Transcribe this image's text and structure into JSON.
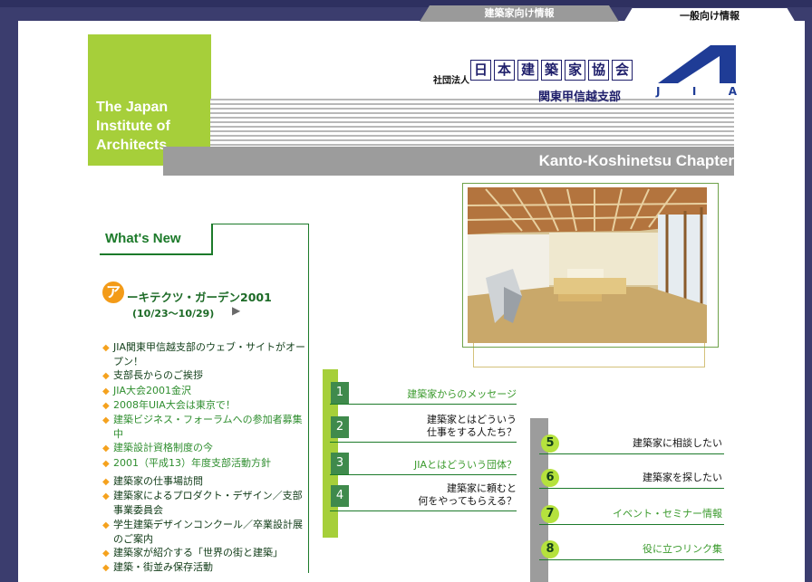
{
  "tabs": [
    {
      "label": "建築家向け情報"
    },
    {
      "label": "一般向け情報"
    }
  ],
  "logo": {
    "text": "The Japan\nInstitute of\nArchitects"
  },
  "header": {
    "org_prefix": "社団法人",
    "org_chars": [
      "日",
      "本",
      "建",
      "築",
      "家",
      "協",
      "会"
    ],
    "branch": "関東甲信越支部",
    "mark_letters": [
      "J",
      "I",
      "A"
    ],
    "chapter": "Kanto-Koshinetsu Chapter"
  },
  "whats_new": {
    "title": "What's New",
    "feature": {
      "icon": "ア",
      "title": "ーキテクツ・ガーデン2001",
      "date": "(10/23〜10/29)",
      "arrow": "▶"
    },
    "news_group1": [
      {
        "text": "JIA関東甲信越支部のウェブ・サイトがオープン！",
        "color": "dark"
      },
      {
        "text": "支部長からのご挨拶",
        "color": "dark"
      },
      {
        "text": "JIA大会2001金沢",
        "color": "green"
      },
      {
        "text": "2008年UIA大会は東京で！",
        "color": "green"
      },
      {
        "text": "建築ビジネス・フォーラムへの参加者募集中",
        "color": "green"
      },
      {
        "text": "建築設計資格制度の今",
        "color": "green"
      },
      {
        "text": "2001（平成13）年度支部活動方針",
        "color": "green"
      }
    ],
    "news_group2": [
      {
        "text": "建築家の仕事場訪問"
      },
      {
        "text": "建築家によるプロダクト・デザイン／支部事業委員会"
      },
      {
        "text": "学生建築デザインコンクール／卒業設計展のご案内"
      },
      {
        "text": "建築家が紹介する「世界の街と建築」"
      },
      {
        "text": "建築・街並み保存活動"
      }
    ]
  },
  "mid_menu": [
    {
      "num": "1",
      "label": "建築家からのメッセージ",
      "color": "#3a9a2c"
    },
    {
      "num": "2",
      "label": "建築家とはどういう\n仕事をする人たち？",
      "color": "#111111"
    },
    {
      "num": "3",
      "label": "JIAとはどういう団体？",
      "color": "#3a9a2c"
    },
    {
      "num": "4",
      "label": "建築家に頼むと\n何をやってもらえる？",
      "color": "#111111"
    }
  ],
  "right_menu": [
    {
      "num": "5",
      "label": "建築家に相談したい",
      "color": "#111111"
    },
    {
      "num": "6",
      "label": "建築家を探したい",
      "color": "#111111"
    },
    {
      "num": "7",
      "label": "イベント・セミナー情報",
      "color": "#3a9a2c"
    },
    {
      "num": "8",
      "label": "役に立つリンク集",
      "color": "#3a9a2c"
    }
  ],
  "colors": {
    "accent_green": "#a6cf3a",
    "dark_green": "#1c7a2a",
    "bullet_orange": "#f5a21e",
    "bar_gray": "#9c9c9c",
    "navy": "#1f1f6b"
  }
}
